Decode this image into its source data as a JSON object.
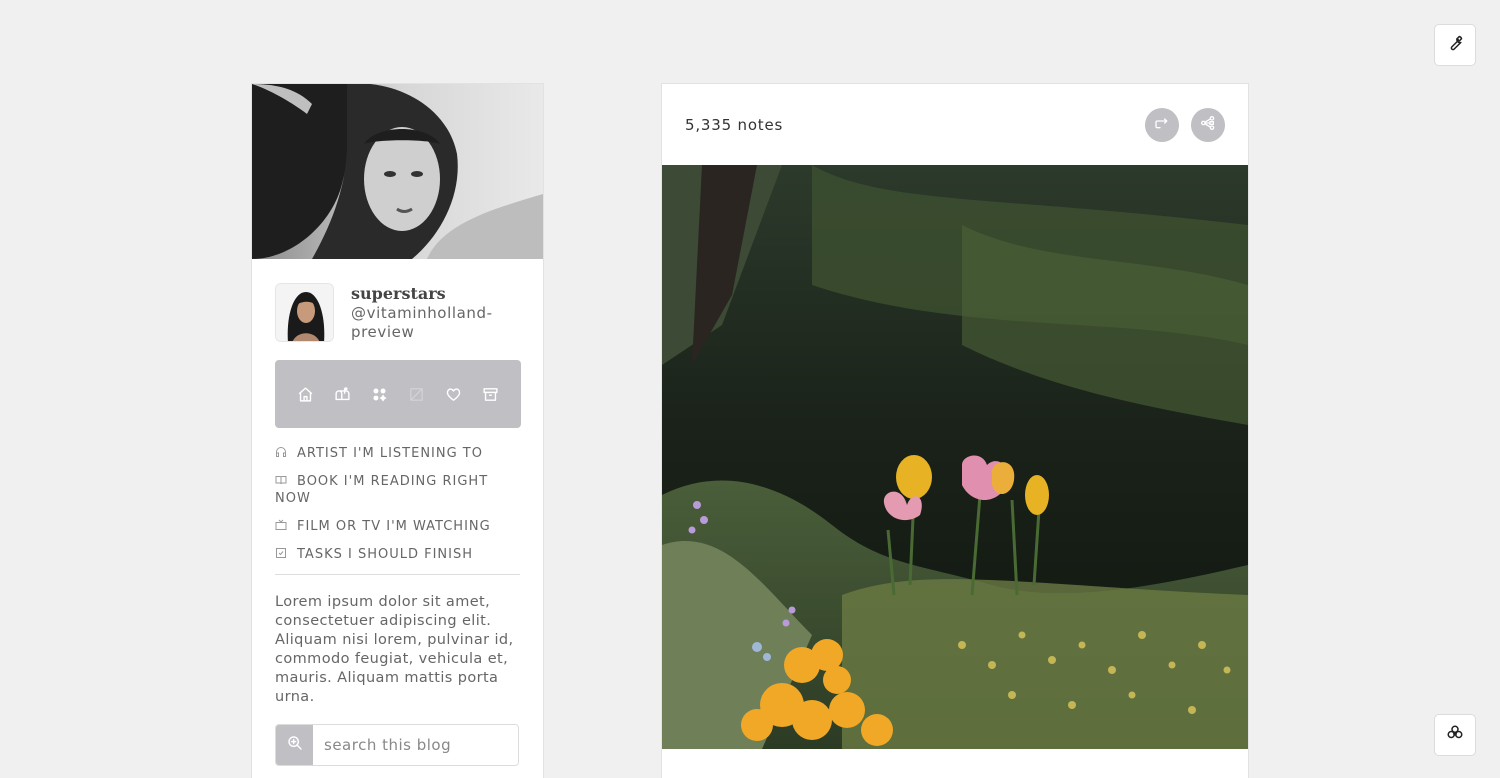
{
  "corner": {
    "customize_icon": "wrench-icon",
    "theme_icon": "flower-icon"
  },
  "sidebar": {
    "header_image": "black-and-white portrait photo",
    "avatar": "avatar portrait",
    "title": "superstars",
    "handle": "@vitaminholland-preview",
    "nav_icons": [
      "home-icon",
      "mailbox-icon",
      "grid-icon",
      "blank-icon",
      "heart-icon",
      "archive-icon"
    ],
    "links": [
      {
        "icon": "headphones-icon",
        "label": "ARTIST I'M LISTENING TO"
      },
      {
        "icon": "book-icon",
        "label": "BOOK I'M READING RIGHT NOW"
      },
      {
        "icon": "tv-icon",
        "label": "FILM OR TV I'M WATCHING"
      },
      {
        "icon": "checkbox-icon",
        "label": "TASKS I SHOULD FINISH"
      }
    ],
    "description": "Lorem ipsum dolor sit amet, consectetuer adipiscing elit. Aliquam nisi lorem, pulvinar id, commodo feugiat, vehicula et, mauris. Aliquam mattis porta urna.",
    "search": {
      "placeholder": "search this blog",
      "value": ""
    }
  },
  "post": {
    "notes": "5,335 notes",
    "actions": [
      "reblog-icon",
      "share-icon"
    ],
    "photo": "photo of tulips and wildflowers in a dark garden"
  },
  "colors": {
    "background": "#f0f0f0",
    "accent_gray": "#bfbfc4",
    "panel": "#ffffff"
  }
}
